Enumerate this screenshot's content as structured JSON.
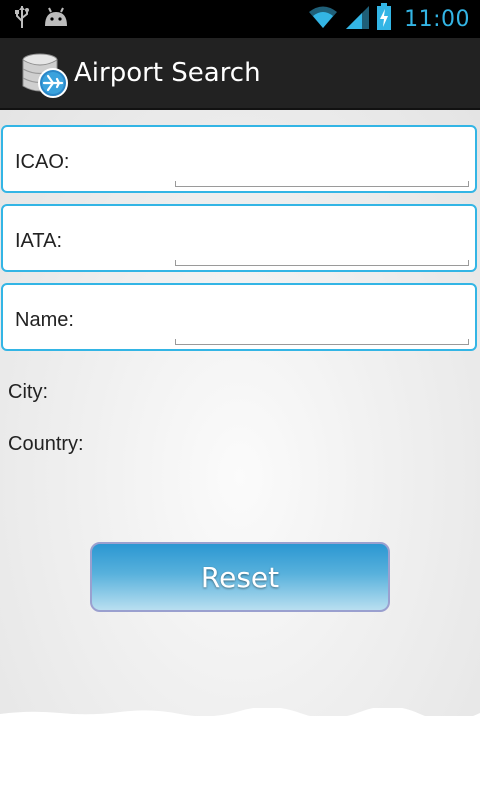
{
  "status_bar": {
    "time": "11:00",
    "icons": [
      "usb-icon",
      "android-icon",
      "wifi-icon",
      "signal-icon",
      "battery-charging-icon"
    ]
  },
  "action_bar": {
    "title": "Airport Search",
    "icon": "database-airport-icon"
  },
  "form": {
    "icao": {
      "label": "ICAO:",
      "value": ""
    },
    "iata": {
      "label": "IATA:",
      "value": ""
    },
    "name": {
      "label": "Name:",
      "value": ""
    }
  },
  "info": {
    "city_label": "City:",
    "country_label": "Country:"
  },
  "buttons": {
    "reset_label": "Reset"
  },
  "colors": {
    "accent": "#33b5e5",
    "action_bar": "#222222",
    "button_top": "#2b97d2",
    "button_bottom": "#b9dff0"
  }
}
